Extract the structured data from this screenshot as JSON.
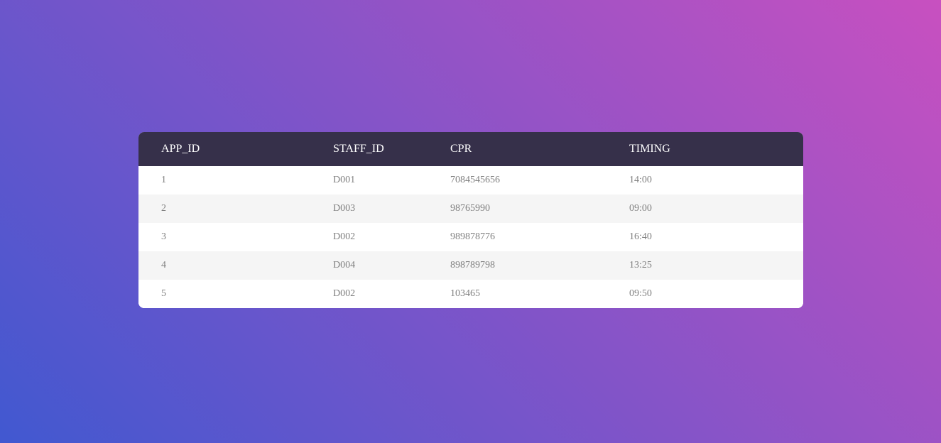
{
  "table": {
    "columns": [
      "APP_ID",
      "STAFF_ID",
      "CPR",
      "TIMING"
    ],
    "rows": [
      [
        "1",
        "D001",
        "7084545656",
        "14:00"
      ],
      [
        "2",
        "D003",
        "98765990",
        "09:00"
      ],
      [
        "3",
        "D002",
        "989878776",
        "16:40"
      ],
      [
        "4",
        "D004",
        "898789798",
        "13:25"
      ],
      [
        "5",
        "D002",
        "103465",
        "09:50"
      ]
    ]
  },
  "colors": {
    "gradient_start": "#4158d0",
    "gradient_end": "#c850c0",
    "header_bg": "#36304a",
    "row_alt_bg": "#f5f5f5",
    "cell_text": "#808080"
  }
}
